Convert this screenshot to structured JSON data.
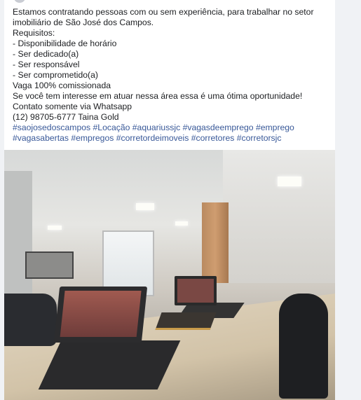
{
  "post": {
    "lines": [
      "Estamos contratando pessoas com ou sem experiência, para trabalhar no setor",
      "imobiliário de São José dos Campos.",
      "Requisitos:",
      "- Disponibilidade de horário",
      "- Ser dedicado(a)",
      "- Ser responsável",
      "- Ser comprometido(a)",
      "Vaga 100% comissionada",
      "Se você tem interesse em atuar nessa área essa é uma ótima oportunidade!",
      "Contato somente via Whatsapp",
      "(12) 98705-6777 Taina Gold"
    ],
    "hashtags": [
      "#saojosedoscampos",
      "#Locação",
      "#aquariussjc",
      "#vagasdeemprego",
      "#emprego",
      "#vagasabertas",
      "#empregos",
      "#corretordeimoveis",
      "#corretores",
      "#corretorsjc"
    ],
    "link_color": "#385898"
  }
}
